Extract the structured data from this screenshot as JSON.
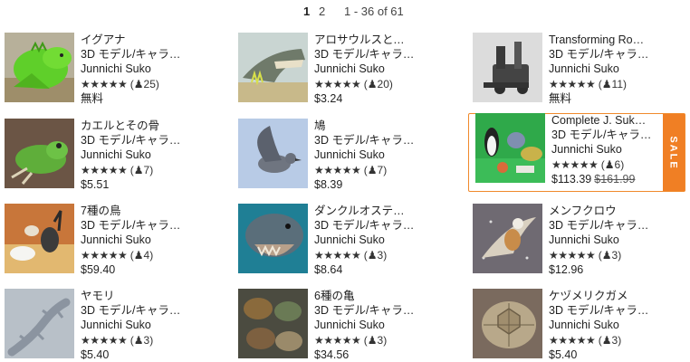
{
  "pagination": {
    "current": "1",
    "next": "2",
    "range": "1 - 36 of 61"
  },
  "products": [
    {
      "title": "イグアナ",
      "category": "3D モデル/キャラ…",
      "author": "Junnichi Suko",
      "stars": "★★★★★",
      "count": "25",
      "price": "無料",
      "old_price": "",
      "thumb": "iguana"
    },
    {
      "title": "アロサウルスとそ…",
      "category": "3D モデル/キャラ…",
      "author": "Junnichi Suko",
      "stars": "★★★★★",
      "count": "20",
      "price": "$3.24",
      "old_price": "",
      "thumb": "dinosaur"
    },
    {
      "title": "Transforming Ro…",
      "category": "3D モデル/キャラ…",
      "author": "Junnichi Suko",
      "stars": "★★★★★",
      "count": "11",
      "price": "無料",
      "old_price": "",
      "thumb": "robot"
    },
    {
      "title": "カエルとその骨",
      "category": "3D モデル/キャラ…",
      "author": "Junnichi Suko",
      "stars": "★★★★★",
      "count": "7",
      "price": "$5.51",
      "old_price": "",
      "thumb": "frog"
    },
    {
      "title": "鳩",
      "category": "3D モデル/キャラ…",
      "author": "Junnichi Suko",
      "stars": "★★★★★",
      "count": "7",
      "price": "$8.39",
      "old_price": "",
      "thumb": "pigeon"
    },
    {
      "title": "Complete J. Suk…",
      "category": "3D モデル/キャラ…",
      "author": "Junnichi Suko",
      "stars": "★★★★★",
      "count": "6",
      "price": "$113.39",
      "old_price": "$161.99",
      "thumb": "collection",
      "sale": "SALE"
    },
    {
      "title": "7種の鳥",
      "category": "3D モデル/キャラ…",
      "author": "Junnichi Suko",
      "stars": "★★★★★",
      "count": "4",
      "price": "$59.40",
      "old_price": "",
      "thumb": "birds"
    },
    {
      "title": "ダンクルオステウス",
      "category": "3D モデル/キャラ…",
      "author": "Junnichi Suko",
      "stars": "★★★★★",
      "count": "3",
      "price": "$8.64",
      "old_price": "",
      "thumb": "fish"
    },
    {
      "title": "メンフクロウ",
      "category": "3D モデル/キャラ…",
      "author": "Junnichi Suko",
      "stars": "★★★★★",
      "count": "3",
      "price": "$12.96",
      "old_price": "",
      "thumb": "owl"
    },
    {
      "title": "ヤモリ",
      "category": "3D モデル/キャラ…",
      "author": "Junnichi Suko",
      "stars": "★★★★★",
      "count": "3",
      "price": "$5.40",
      "old_price": "",
      "thumb": "gecko"
    },
    {
      "title": "6種の亀",
      "category": "3D モデル/キャラ…",
      "author": "Junnichi Suko",
      "stars": "★★★★★",
      "count": "3",
      "price": "$34.56",
      "old_price": "",
      "thumb": "turtles"
    },
    {
      "title": "ケヅメリクガメ",
      "category": "3D モデル/キャラ…",
      "author": "Junnichi Suko",
      "stars": "★★★★★",
      "count": "3",
      "price": "$5.40",
      "old_price": "",
      "thumb": "tortoise"
    }
  ],
  "colors": {
    "sale_accent": "#f07f24",
    "text": "#222222"
  }
}
